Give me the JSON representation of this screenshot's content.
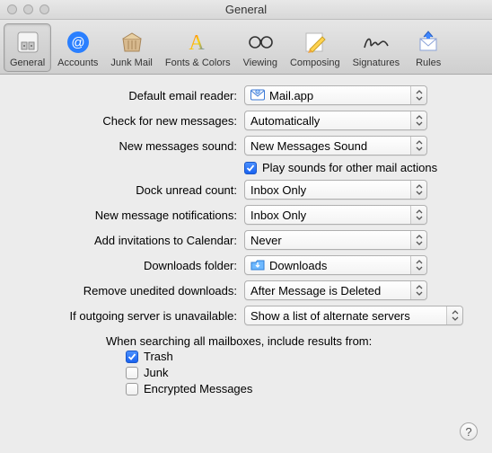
{
  "window": {
    "title": "General"
  },
  "toolbar": {
    "items": [
      {
        "label": "General",
        "icon": "general-icon",
        "selected": true
      },
      {
        "label": "Accounts",
        "icon": "accounts-icon",
        "selected": false
      },
      {
        "label": "Junk Mail",
        "icon": "junkmail-icon",
        "selected": false
      },
      {
        "label": "Fonts & Colors",
        "icon": "fonts-icon",
        "selected": false
      },
      {
        "label": "Viewing",
        "icon": "viewing-icon",
        "selected": false
      },
      {
        "label": "Composing",
        "icon": "composing-icon",
        "selected": false
      },
      {
        "label": "Signatures",
        "icon": "signatures-icon",
        "selected": false
      },
      {
        "label": "Rules",
        "icon": "rules-icon",
        "selected": false
      }
    ]
  },
  "prefs": {
    "default_reader": {
      "label": "Default email reader:",
      "value": "Mail.app",
      "value_icon": "mail-app-icon"
    },
    "check_messages": {
      "label": "Check for new messages:",
      "value": "Automatically"
    },
    "sound": {
      "label": "New messages sound:",
      "value": "New Messages Sound"
    },
    "play_sounds": {
      "label": "Play sounds for other mail actions",
      "checked": true
    },
    "dock_count": {
      "label": "Dock unread count:",
      "value": "Inbox Only"
    },
    "notifications": {
      "label": "New message notifications:",
      "value": "Inbox Only"
    },
    "calendar": {
      "label": "Add invitations to Calendar:",
      "value": "Never"
    },
    "downloads": {
      "label": "Downloads folder:",
      "value": "Downloads",
      "value_icon": "downloads-folder-icon"
    },
    "remove_downloads": {
      "label": "Remove unedited downloads:",
      "value": "After Message is Deleted"
    },
    "outgoing": {
      "label": "If outgoing server is unavailable:",
      "value": "Show a list of alternate servers"
    },
    "search_heading": "When searching all mailboxes, include results from:",
    "search_trash": {
      "label": "Trash",
      "checked": true
    },
    "search_junk": {
      "label": "Junk",
      "checked": false
    },
    "search_encrypted": {
      "label": "Encrypted Messages",
      "checked": false
    }
  },
  "help_tooltip": "?"
}
